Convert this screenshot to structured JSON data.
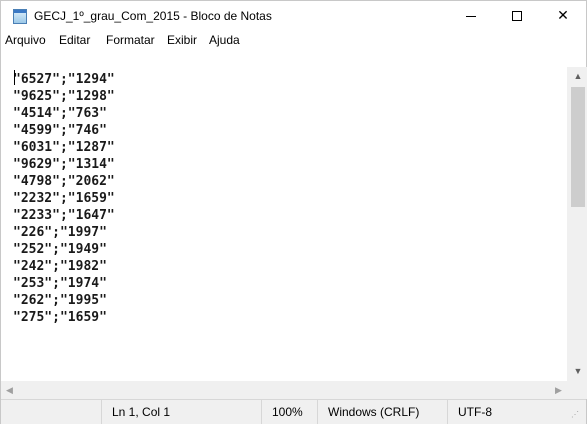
{
  "window": {
    "title": "GECJ_1º_grau_Com_2015 - Bloco de Notas",
    "controls": {
      "minimize": "minimize",
      "maximize": "maximize",
      "close": "✕"
    }
  },
  "menu": {
    "items": [
      "Arquivo",
      "Editar",
      "Formatar",
      "Exibir",
      "Ajuda"
    ]
  },
  "editor": {
    "lines": [
      "\"6527\";\"1294\"",
      "\"9625\";\"1298\"",
      "\"4514\";\"763\"",
      "\"4599\";\"746\"",
      "\"6031\";\"1287\"",
      "\"9629\";\"1314\"",
      "\"4798\";\"2062\"",
      "\"2232\";\"1659\"",
      "\"2233\";\"1647\"",
      "\"226\";\"1997\"",
      "\"252\";\"1949\"",
      "\"242\";\"1982\"",
      "\"253\";\"1974\"",
      "\"262\";\"1995\"",
      "\"275\";\"1659\""
    ]
  },
  "scrollbars": {
    "up": "▲",
    "down": "▼",
    "left": "◀",
    "right": "▶"
  },
  "statusbar": {
    "position": "Ln 1, Col 1",
    "zoom": "100%",
    "line_ending": "Windows (CRLF)",
    "encoding": "UTF-8"
  },
  "icons": {
    "app": "notepad-icon",
    "grip": "resize-grip-icon"
  },
  "colors": {
    "chrome": "#f0f0f0",
    "text": "#1a1a1a",
    "thumb": "#cdcdcd"
  }
}
